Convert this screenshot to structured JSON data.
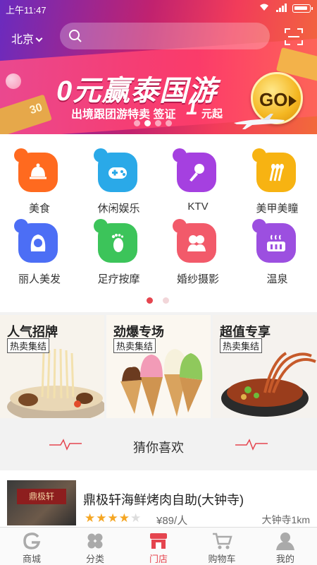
{
  "status_bar": {
    "time": "上午11:47"
  },
  "header": {
    "city": "北京"
  },
  "banner": {
    "title": "0元赢泰国游",
    "subtitle": "出境跟团游特卖  签证",
    "price_number": "1",
    "price_suffix": "元起",
    "go_label": "GO",
    "ticket_text": "30",
    "slide_count": 4,
    "active_slide": 1
  },
  "categories": [
    {
      "label": "美食",
      "icon": "cloche-icon",
      "color": "#ff6a1f"
    },
    {
      "label": "休闲娱乐",
      "icon": "gamepad-icon",
      "color": "#2aa9e8"
    },
    {
      "label": "KTV",
      "icon": "microphone-icon",
      "color": "#a540e0"
    },
    {
      "label": "美甲美瞳",
      "icon": "nail-polish-icon",
      "color": "#f7b312"
    },
    {
      "label": "丽人美发",
      "icon": "woman-hair-icon",
      "color": "#4c6ef5"
    },
    {
      "label": "足疗按摩",
      "icon": "foot-icon",
      "color": "#3cc45a"
    },
    {
      "label": "婚纱摄影",
      "icon": "couple-icon",
      "color": "#f25a6a"
    },
    {
      "label": "温泉",
      "icon": "hot-spring-icon",
      "color": "#9c4fe0"
    }
  ],
  "features": [
    {
      "title": "人气招牌",
      "tag": "热卖集结",
      "image": "noodle-bowl-image"
    },
    {
      "title": "劲爆专场",
      "tag": "热卖集结",
      "image": "ice-cream-cones-image"
    },
    {
      "title": "超值专享",
      "tag": "热卖集结",
      "image": "hotpot-noodles-image"
    }
  ],
  "guess": {
    "title": "猜你喜欢"
  },
  "listing": {
    "name": "鼎极轩海鲜烤肉自助(大钟寺)",
    "stars_filled": "★★★★",
    "stars_empty": "★",
    "rating": 4,
    "price": "¥89/人",
    "distance": "大钟寺1km",
    "thumb_sign": "鼎极轩"
  },
  "nav": [
    {
      "label": "商城",
      "icon": "mall-g-icon",
      "active": false
    },
    {
      "label": "分类",
      "icon": "category-clover-icon",
      "active": false
    },
    {
      "label": "门店",
      "icon": "store-icon",
      "active": true
    },
    {
      "label": "购物车",
      "icon": "cart-icon",
      "active": false
    },
    {
      "label": "我的",
      "icon": "profile-icon",
      "active": false
    }
  ],
  "colors": {
    "accent": "#e5454f",
    "star": "#f5a623"
  }
}
